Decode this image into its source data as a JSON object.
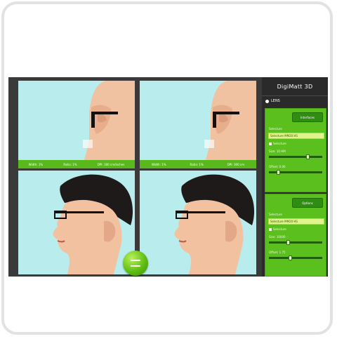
{
  "app": {
    "title": "DigiMatt 3D",
    "menu_label": "LENS"
  },
  "viewports": {
    "top_left": {
      "info": [
        "Width: 1%",
        "Ratio: 1%",
        "DPI: 300 cm/inches"
      ]
    },
    "top_right": {
      "info": [
        "Width: 1%",
        "Ratio: 1%",
        "DPI: 300 cm"
      ]
    }
  },
  "panel_left": {
    "button_label": "Interfaces",
    "selector_label": "Selecture",
    "selector_value": "Selecture MM20 HS",
    "checkbox_label": "Selecture",
    "size_label": "Size: 10 HM",
    "offset_label": "Offset: 0.00",
    "size_level": 0.75,
    "offset_level": 0.15
  },
  "panel_right": {
    "button_label": "Options",
    "selector_label": "Selecture",
    "selector_value": "Selecture MM20 HS",
    "checkbox_label": "Selecture",
    "size_label": "Size: 10000",
    "offset_label": "Offset: 1.75",
    "size_level": 0.35,
    "offset_level": 0.4
  },
  "colors": {
    "accent": "#5bbf1d",
    "sidebar": "#2a2a2a",
    "viewport_bg": "#b9ecec",
    "skin": "#f2c2a0",
    "hair": "#1e1a19"
  },
  "icons": {
    "toggle": "equals-icon",
    "menu_bullet": "dot-icon"
  }
}
